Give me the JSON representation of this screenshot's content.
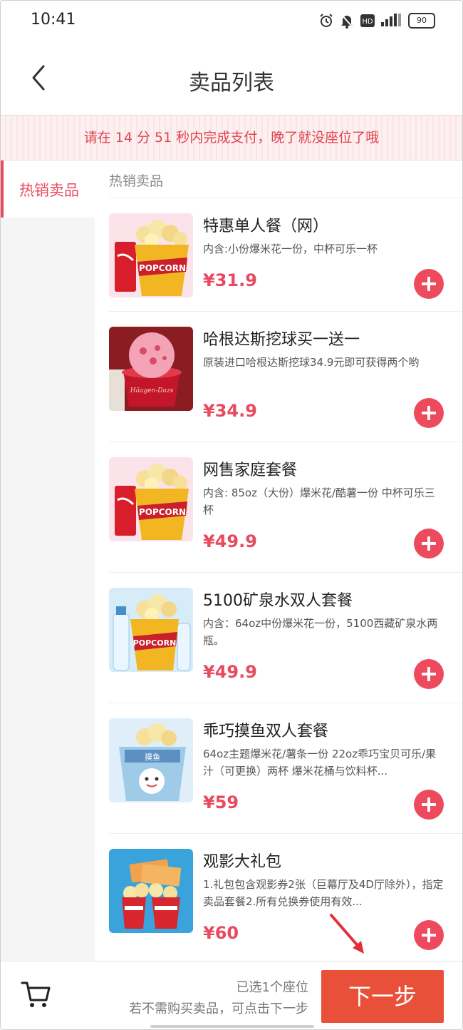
{
  "status_bar": {
    "time": "10:41",
    "battery": "90"
  },
  "header": {
    "title": "卖品列表"
  },
  "banner": {
    "text": "请在 14 分 51 秒内完成支付，晚了就没座位了哦"
  },
  "sidebar": {
    "items": [
      {
        "label": "热销卖品",
        "active": true
      }
    ]
  },
  "section": {
    "title": "热销卖品"
  },
  "products": [
    {
      "name": "特惠单人餐（网）",
      "desc": "内含:小份爆米花一份，中杯可乐一杯",
      "price": "¥31.9",
      "image": "popcorn-cola-icon"
    },
    {
      "name": "哈根达斯挖球买一送一",
      "desc": "原装进口哈根达斯挖球34.9元即可获得两个哟",
      "price": "¥34.9",
      "image": "ice-cream-icon"
    },
    {
      "name": "网售家庭套餐",
      "desc": "内含: 85oz（大份）爆米花/酷薯一份 中杯可乐三杯",
      "price": "¥49.9",
      "image": "popcorn-cola-icon"
    },
    {
      "name": "5100矿泉水双人套餐",
      "desc": "内含：64oz中份爆米花一份，5100西藏矿泉水两瓶。",
      "price": "¥49.9",
      "image": "popcorn-water-icon"
    },
    {
      "name": "乖巧摸鱼双人套餐",
      "desc": "64oz主题爆米花/薯条一份 22oz乖巧宝贝可乐/果汁（可更换）两杯 爆米花桶与饮料杯...",
      "price": "¥59",
      "image": "themed-bucket-icon"
    },
    {
      "name": "观影大礼包",
      "desc": "1.礼包包含观影券2张（巨幕厅及4D厅除外），指定卖品套餐2.所有兑换券使用有效...",
      "price": "¥60",
      "image": "gift-pack-icon"
    }
  ],
  "bottom_bar": {
    "seat_selected": "已选1个座位",
    "hint": "若不需购买卖品，可点击下一步",
    "next_label": "下一步"
  },
  "colors": {
    "accent": "#e84a5f",
    "next_button": "#e8503a",
    "banner_bg": "#fdf0f1"
  }
}
